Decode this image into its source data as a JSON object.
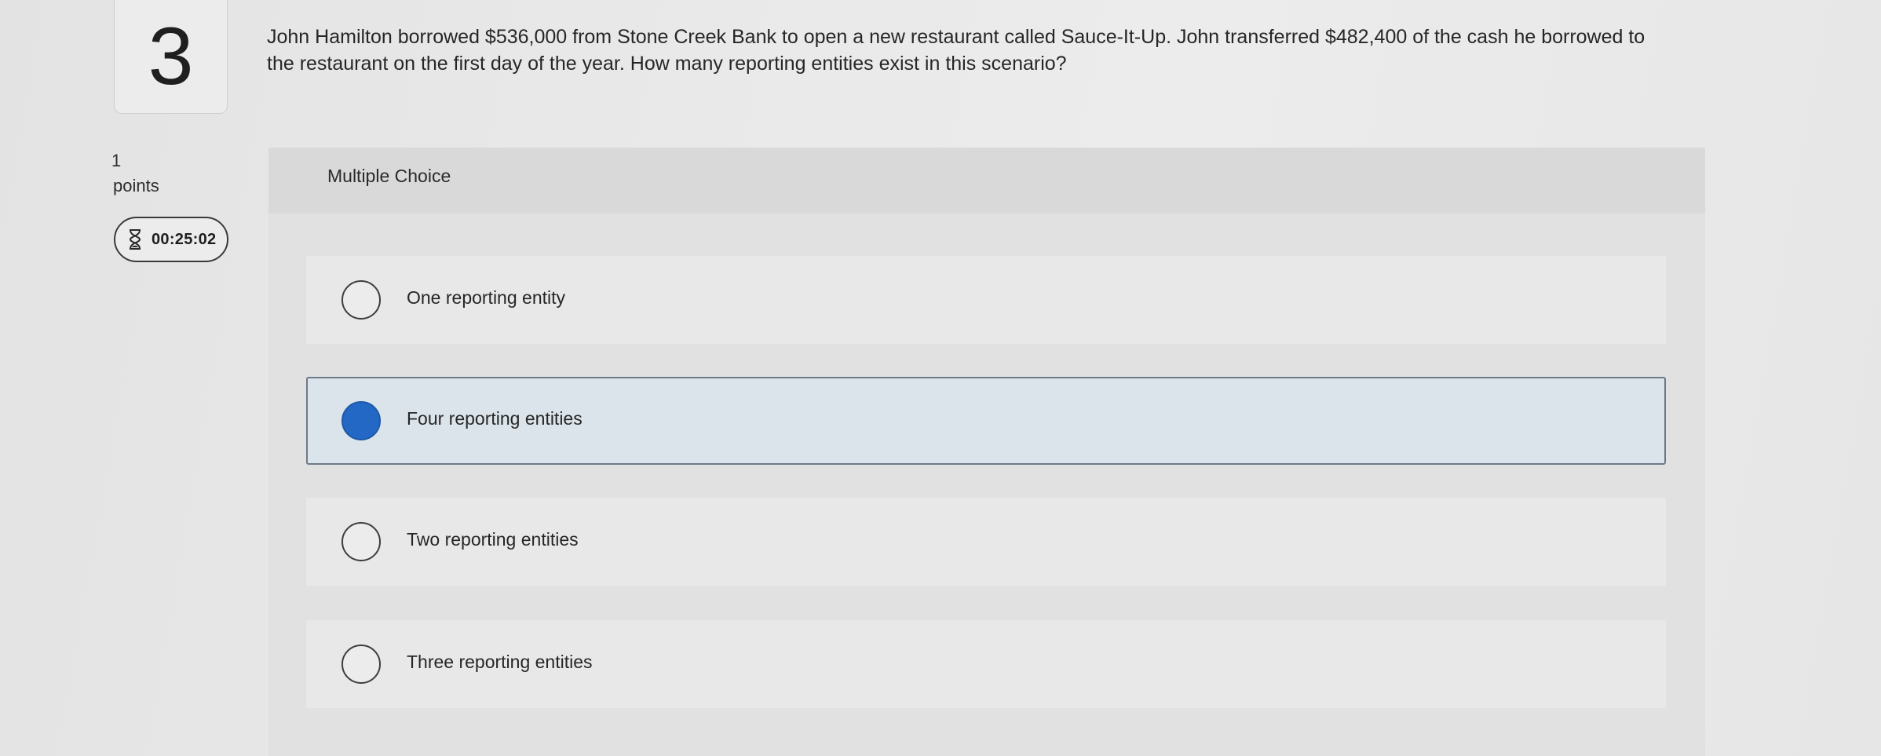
{
  "question": {
    "number": "3",
    "points_value": "1",
    "points_label": "points",
    "timer": "00:25:02",
    "text": "John Hamilton borrowed $536,000 from Stone Creek Bank to open a new restaurant called Sauce-It-Up. John transferred $482,400 of the cash he borrowed to the restaurant on the first day of the year. How many reporting entities exist in this scenario?"
  },
  "answer_panel": {
    "title": "Multiple Choice",
    "options": [
      {
        "label": "One reporting entity",
        "selected": false
      },
      {
        "label": "Four reporting entities",
        "selected": true
      },
      {
        "label": "Two reporting entities",
        "selected": false
      },
      {
        "label": "Three reporting entities",
        "selected": false
      }
    ]
  },
  "icons": {
    "timer": "hourglass-icon"
  },
  "colors": {
    "selected_radio": "#2368c4",
    "selected_option_bg": "#dbe4ea"
  }
}
